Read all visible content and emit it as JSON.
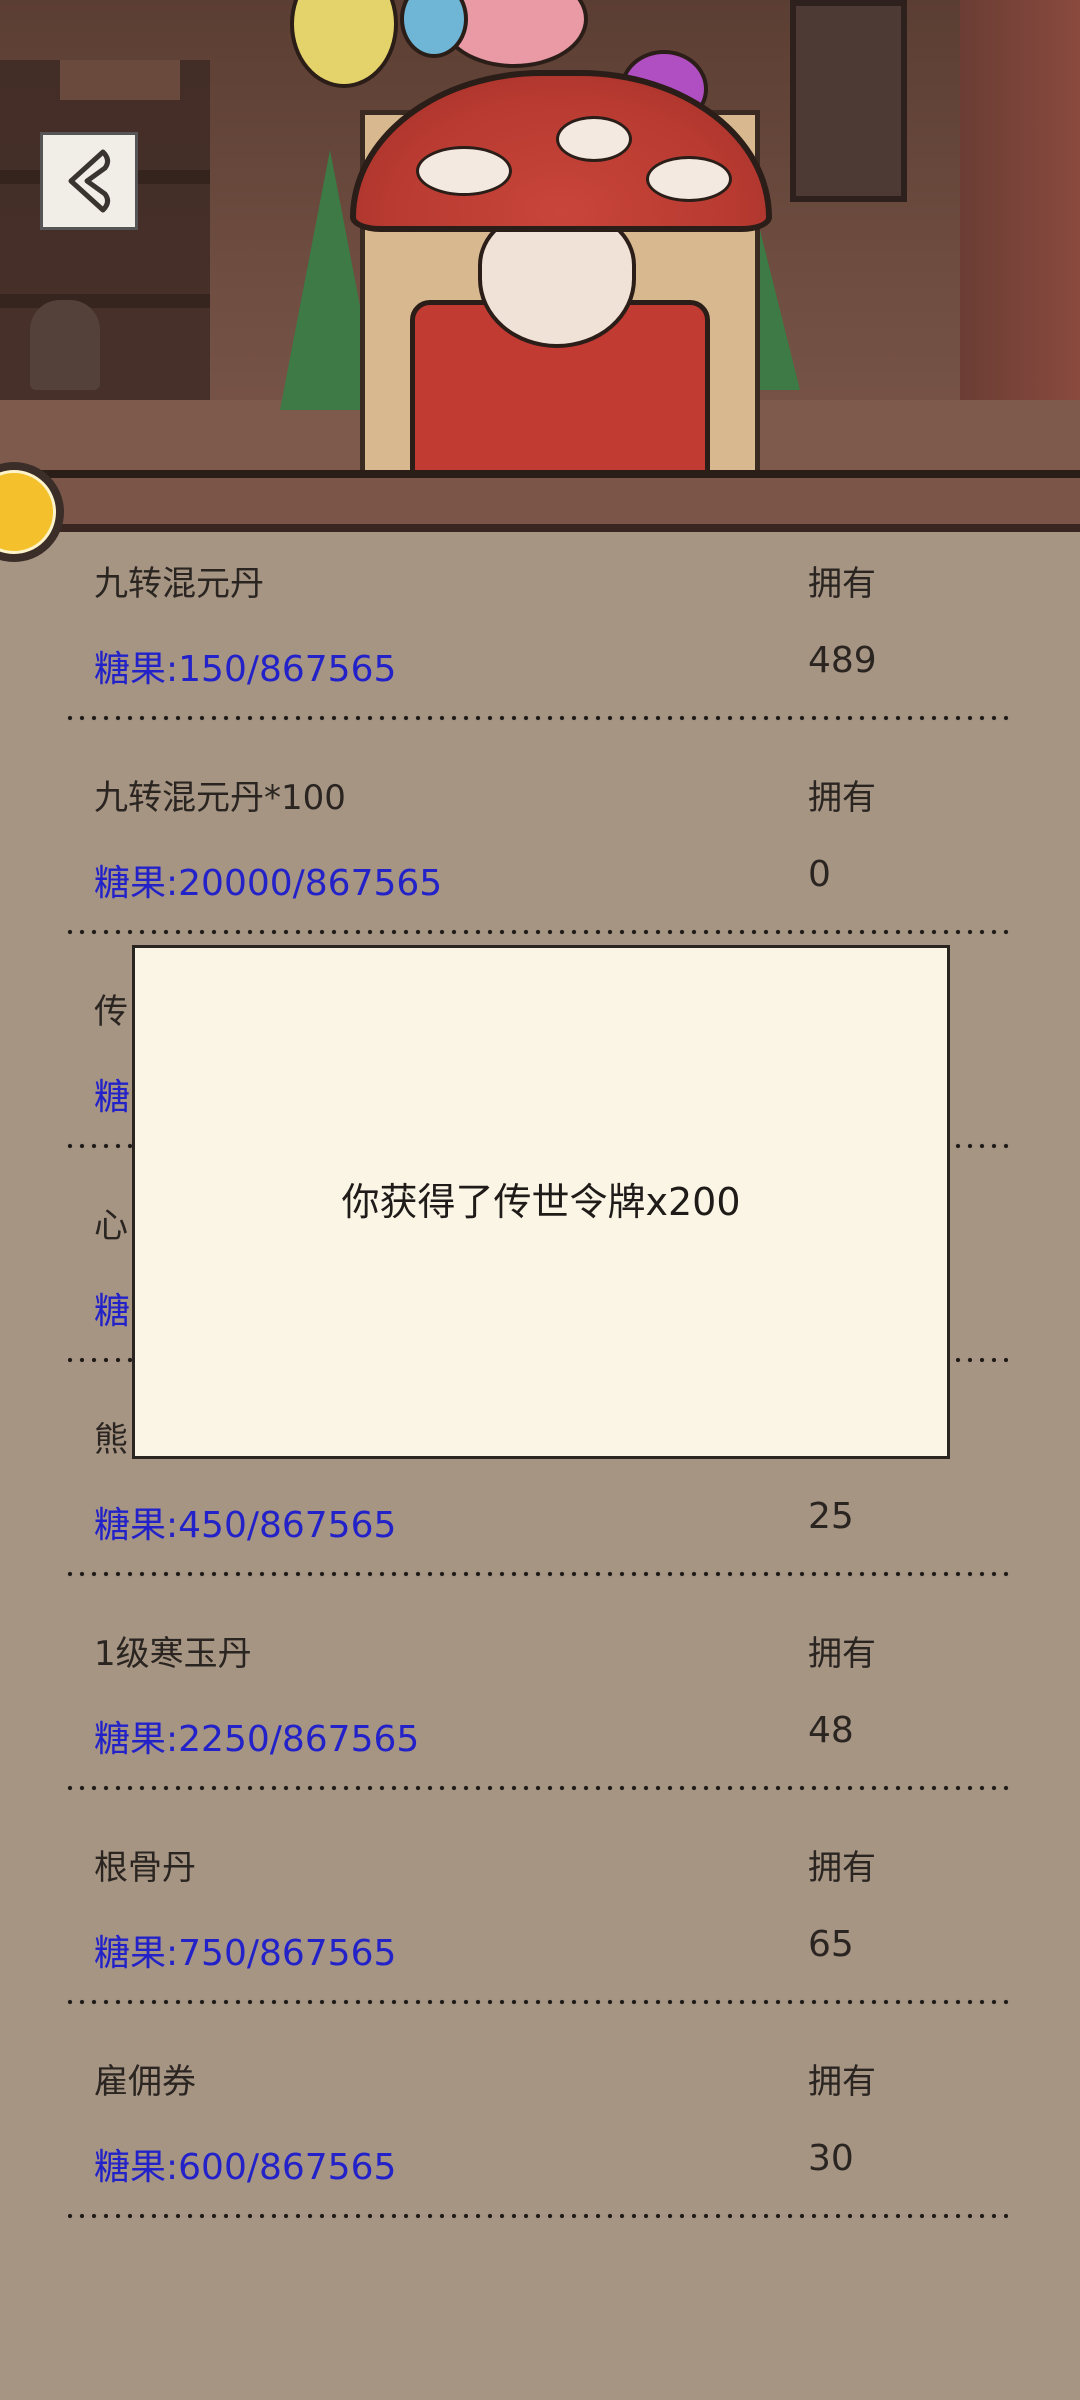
{
  "back_button": {
    "icon": "back-arrow-icon"
  },
  "items": [
    {
      "name": "九转混元丹",
      "own_label": "拥有",
      "price": "糖果:150/867565",
      "owned": "489"
    },
    {
      "name": "九转混元丹*100",
      "own_label": "拥有",
      "price": "糖果:20000/867565",
      "owned": "0"
    },
    {
      "name": "传",
      "own_label": "",
      "price": "糖",
      "owned": ""
    },
    {
      "name": "心",
      "own_label": "",
      "price": "糖",
      "owned": ""
    },
    {
      "name": "熊",
      "own_label": "",
      "price": "糖果:450/867565",
      "owned": "25"
    },
    {
      "name": "1级寒玉丹",
      "own_label": "拥有",
      "price": "糖果:2250/867565",
      "owned": "48"
    },
    {
      "name": "根骨丹",
      "own_label": "拥有",
      "price": "糖果:750/867565",
      "owned": "65"
    },
    {
      "name": "雇佣券",
      "own_label": "拥有",
      "price": "糖果:600/867565",
      "owned": "30"
    }
  ],
  "dialog": {
    "message": "你获得了传世令牌x200"
  },
  "colors": {
    "background": "#a79584",
    "price_text": "#2222c8",
    "dialog_bg": "#fbf5e6"
  }
}
